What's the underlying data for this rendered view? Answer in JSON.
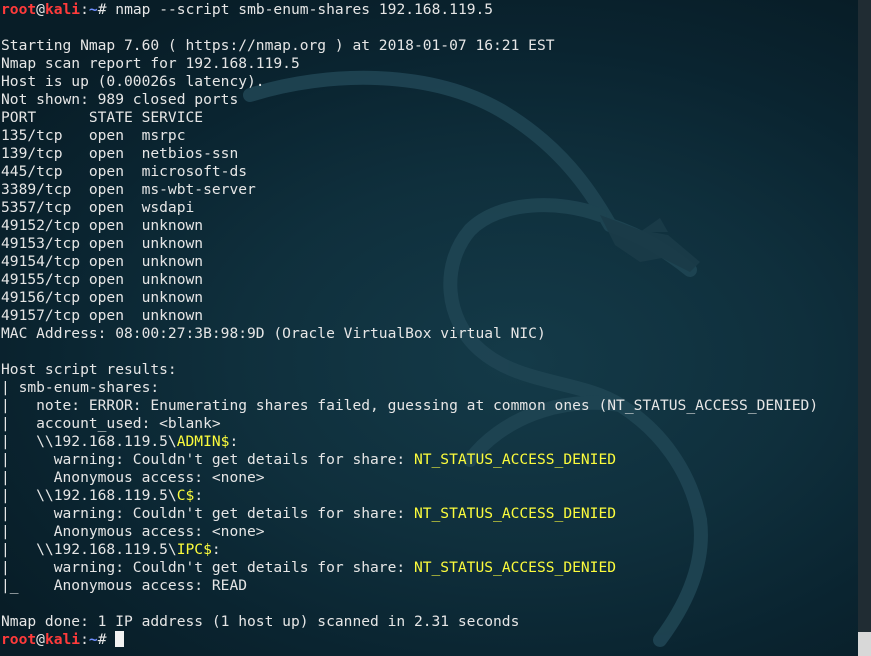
{
  "colors": {
    "background": "#0b2633",
    "text": "#e6e6e6",
    "prompt_user": "#ff3b3b",
    "prompt_path": "#6f8fff",
    "highlight": "#fcfc3c",
    "scrollbar_thumb": "#d8d8d8"
  },
  "prompt": {
    "user": "root",
    "at": "@",
    "host": "kali",
    "sep": ":",
    "path": "~",
    "symbol": "# "
  },
  "command": "nmap --script smb-enum-shares 192.168.119.5",
  "output": {
    "starting": "Starting Nmap 7.60 ( https://nmap.org ) at 2018-01-07 16:21 EST",
    "report": "Nmap scan report for 192.168.119.5",
    "host_up": "Host is up (0.00026s latency).",
    "not_shown": "Not shown: 989 closed ports",
    "ports_header": "PORT      STATE SERVICE",
    "ports": [
      "135/tcp   open  msrpc",
      "139/tcp   open  netbios-ssn",
      "445/tcp   open  microsoft-ds",
      "3389/tcp  open  ms-wbt-server",
      "5357/tcp  open  wsdapi",
      "49152/tcp open  unknown",
      "49153/tcp open  unknown",
      "49154/tcp open  unknown",
      "49155/tcp open  unknown",
      "49156/tcp open  unknown",
      "49157/tcp open  unknown"
    ],
    "mac": "MAC Address: 08:00:27:3B:98:9D (Oracle VirtualBox virtual NIC)",
    "script_results": "Host script results:",
    "script_name": "| smb-enum-shares: ",
    "note": "|   note: ERROR: Enumerating shares failed, guessing at common ones (NT_STATUS_ACCESS_DENIED)",
    "account_used": "|   account_used: <blank>",
    "shares": [
      {
        "prefix": "|   \\\\192.168.119.5\\",
        "name": "ADMIN$",
        "suffix": ":",
        "warning_prefix": "|     warning: Couldn't get details for share: ",
        "warning_status": "NT_STATUS_ACCESS_DENIED",
        "access": "|     Anonymous access: <none>"
      },
      {
        "prefix": "|   \\\\192.168.119.5\\",
        "name": "C$",
        "suffix": ":",
        "warning_prefix": "|     warning: Couldn't get details for share: ",
        "warning_status": "NT_STATUS_ACCESS_DENIED",
        "access": "|     Anonymous access: <none>"
      },
      {
        "prefix": "|   \\\\192.168.119.5\\",
        "name": "IPC$",
        "suffix": ":",
        "warning_prefix": "|     warning: Couldn't get details for share: ",
        "warning_status": "NT_STATUS_ACCESS_DENIED",
        "access": "|_    Anonymous access: READ"
      }
    ],
    "done": "Nmap done: 1 IP address (1 host up) scanned in 2.31 seconds"
  }
}
